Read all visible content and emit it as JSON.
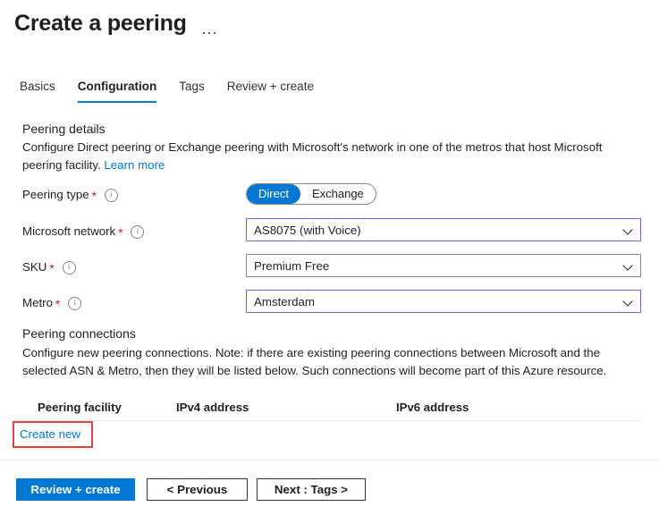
{
  "header": {
    "title": "Create a peering",
    "more_menu": "..."
  },
  "tabs": [
    {
      "label": "Basics",
      "active": false
    },
    {
      "label": "Configuration",
      "active": true
    },
    {
      "label": "Tags",
      "active": false
    },
    {
      "label": "Review + create",
      "active": false
    }
  ],
  "peering_details": {
    "heading": "Peering details",
    "description": "Configure Direct peering or Exchange peering with Microsoft's network in one of the metros that host Microsoft peering facility.",
    "learn_more": "Learn more",
    "fields": {
      "peering_type": {
        "label": "Peering type",
        "required": "*",
        "options": [
          "Direct",
          "Exchange"
        ],
        "selected": "Direct"
      },
      "microsoft_network": {
        "label": "Microsoft network",
        "required": "*",
        "value": "AS8075 (with Voice)"
      },
      "sku": {
        "label": "SKU",
        "required": "*",
        "value": "Premium Free"
      },
      "metro": {
        "label": "Metro",
        "required": "*",
        "value": "Amsterdam"
      }
    }
  },
  "peering_connections": {
    "heading": "Peering connections",
    "description": "Configure new peering connections. Note: if there are existing peering connections between Microsoft and the selected ASN & Metro, then they will be listed below. Such connections will become part of this Azure resource.",
    "columns": [
      "Peering facility",
      "IPv4 address",
      "IPv6 address"
    ],
    "rows": [],
    "create_new": "Create new"
  },
  "footer": {
    "review_create": "Review + create",
    "previous": "< Previous",
    "next": "Next : Tags >"
  },
  "colors": {
    "accent": "#0078d4",
    "focus_border": "#8661c5",
    "required": "#a4262c",
    "annotation": "#e8403a"
  }
}
